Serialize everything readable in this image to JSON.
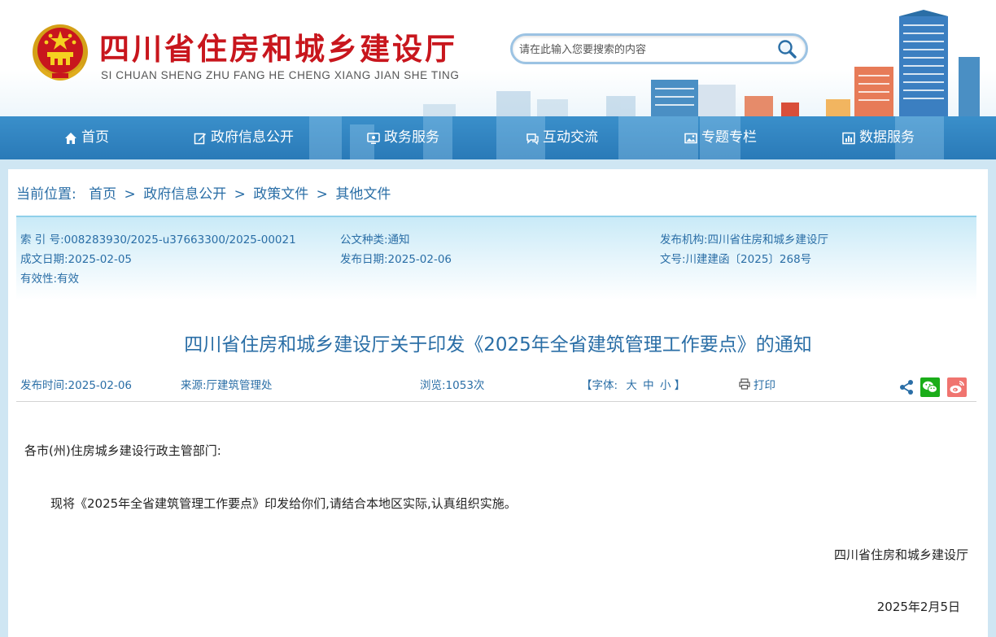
{
  "header": {
    "site_title": "四川省住房和城乡建设厅",
    "site_pinyin": "SI CHUAN SHENG ZHU FANG HE CHENG XIANG JIAN SHE TING",
    "search_placeholder": "请在此输入您要搜索的内容",
    "emblem_icon": "national-emblem-icon",
    "search_icon": "search-icon"
  },
  "nav": {
    "items": [
      {
        "label": "首页",
        "icon": "home-icon"
      },
      {
        "label": "政府信息公开",
        "icon": "edit-icon"
      },
      {
        "label": "政务服务",
        "icon": "monitor-icon"
      },
      {
        "label": "互动交流",
        "icon": "chat-icon"
      },
      {
        "label": "专题专栏",
        "icon": "image-icon"
      },
      {
        "label": "数据服务",
        "icon": "chart-icon"
      }
    ]
  },
  "breadcrumb": {
    "prefix": "当前位置:",
    "items": [
      "首页",
      "政府信息公开",
      "政策文件",
      "其他文件"
    ],
    "separator": ">"
  },
  "meta": {
    "index_no": "索 引 号:008283930/2025-u37663300/2025-00021",
    "doc_type": "公文种类:通知",
    "issuer": "发布机构:四川省住房和城乡建设厅",
    "created_date": "成文日期:2025-02-05",
    "publish_date": "发布日期:2025-02-06",
    "doc_no": "文号:川建建函〔2025〕268号",
    "validity": "有效性:有效"
  },
  "article": {
    "title": "四川省住房和城乡建设厅关于印发《2025年全省建筑管理工作要点》的通知",
    "publish_time": "发布时间:2025-02-06",
    "source": "来源:厅建筑管理处",
    "views": "浏览:1053次",
    "font_size_label": "【字体:",
    "font_large": "大",
    "font_medium": "中",
    "font_small": "小",
    "font_close": "】",
    "print_label": "打印",
    "salutation": "各市(州)住房城乡建设行政主管部门:",
    "paragraph": "现将《2025年全省建筑管理工作要点》印发给你们,请结合本地区实际,认真组织实施。",
    "signature": "四川省住房和城乡建设厅",
    "date": "2025年2月5日"
  },
  "colors": {
    "title_red": "#c8161d",
    "link_blue": "#2a6ea6",
    "nav_blue": "#2f82c0",
    "wechat_green": "#1aad19",
    "weibo_red": "#e6162d"
  }
}
